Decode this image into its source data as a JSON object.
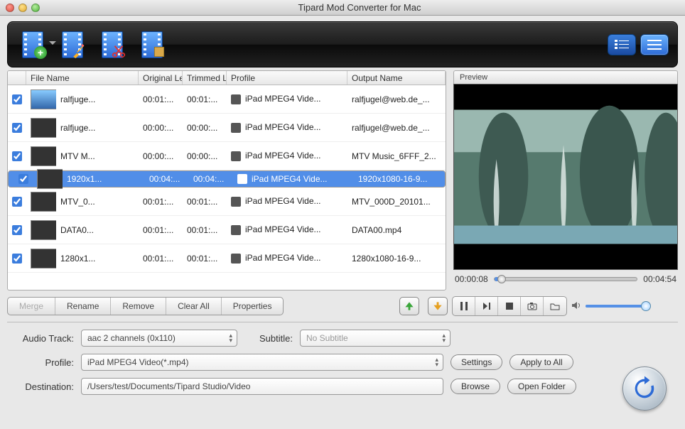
{
  "window": {
    "title": "Tipard Mod Converter for Mac"
  },
  "columns": {
    "filename": "File Name",
    "original": "Original Le",
    "trimmed": "Trimmed L",
    "profile": "Profile",
    "output": "Output Name"
  },
  "rows": [
    {
      "chk": true,
      "name": "ralfjuge...",
      "orig": "00:01:...",
      "trim": "00:01:...",
      "profile": "iPad MPEG4 Vide...",
      "out": "ralfjugel@web.de_...",
      "sel": false
    },
    {
      "chk": true,
      "name": "ralfjuge...",
      "orig": "00:00:...",
      "trim": "00:00:...",
      "profile": "iPad MPEG4 Vide...",
      "out": "ralfjugel@web.de_...",
      "sel": false
    },
    {
      "chk": true,
      "name": "MTV M...",
      "orig": "00:00:...",
      "trim": "00:00:...",
      "profile": "iPad MPEG4 Vide...",
      "out": "MTV Music_6FFF_2...",
      "sel": false
    },
    {
      "chk": true,
      "name": "1920x1...",
      "orig": "00:04:...",
      "trim": "00:04:...",
      "profile": "iPad MPEG4 Vide...",
      "out": "1920x1080-16-9...",
      "sel": true
    },
    {
      "chk": true,
      "name": "MTV_0...",
      "orig": "00:01:...",
      "trim": "00:01:...",
      "profile": "iPad MPEG4 Vide...",
      "out": "MTV_000D_20101...",
      "sel": false
    },
    {
      "chk": true,
      "name": "DATA0...",
      "orig": "00:01:...",
      "trim": "00:01:...",
      "profile": "iPad MPEG4 Vide...",
      "out": "DATA00.mp4",
      "sel": false
    },
    {
      "chk": true,
      "name": "1280x1...",
      "orig": "00:01:...",
      "trim": "00:01:...",
      "profile": "iPad MPEG4 Vide...",
      "out": "1280x1080-16-9...",
      "sel": false
    }
  ],
  "actions": {
    "merge": "Merge",
    "rename": "Rename",
    "remove": "Remove",
    "clear": "Clear All",
    "props": "Properties"
  },
  "preview": {
    "label": "Preview",
    "pos": "00:00:08",
    "dur": "00:04:54"
  },
  "form": {
    "audio_label": "Audio Track:",
    "audio_value": "aac 2 channels (0x110)",
    "subtitle_label": "Subtitle:",
    "subtitle_value": "No Subtitle",
    "profile_label": "Profile:",
    "profile_value": "iPad MPEG4 Video(*.mp4)",
    "settings": "Settings",
    "apply": "Apply to All",
    "dest_label": "Destination:",
    "dest_value": "/Users/test/Documents/Tipard Studio/Video",
    "browse": "Browse",
    "open": "Open Folder"
  }
}
